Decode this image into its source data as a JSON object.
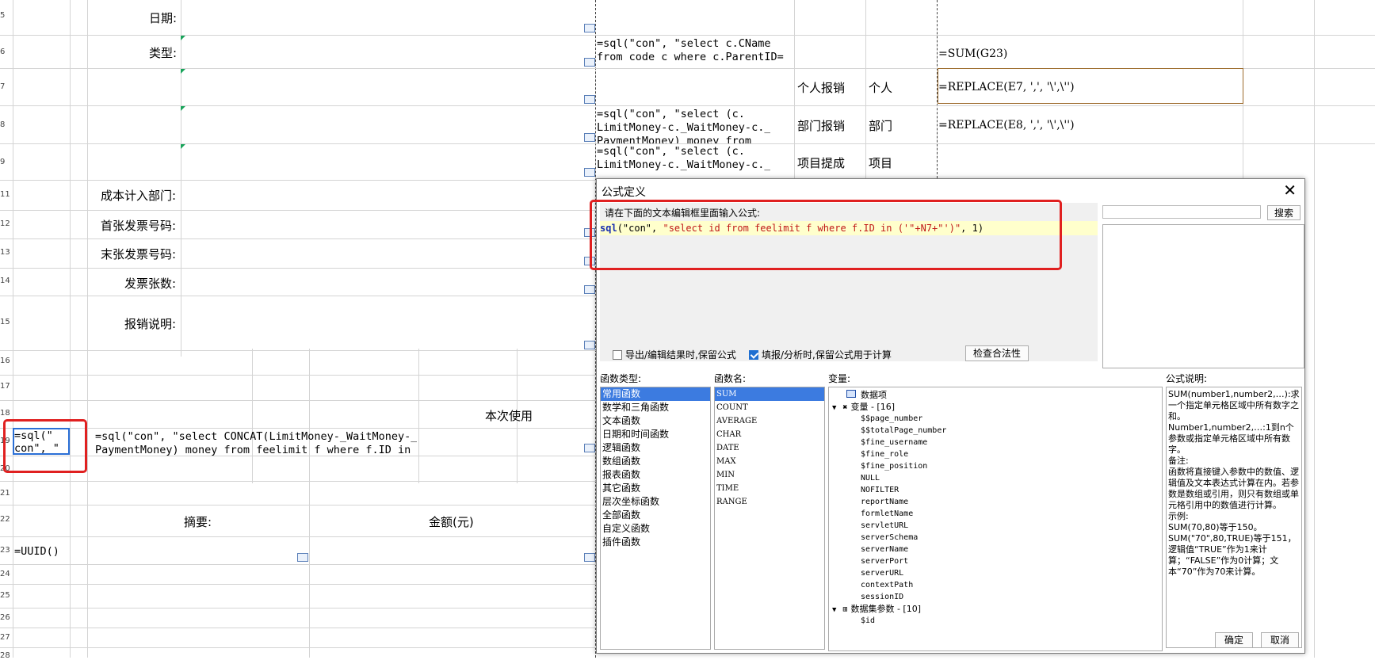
{
  "sheet": {
    "row_numbers": [
      "5",
      "6",
      "7",
      "8",
      "9",
      "11",
      "12",
      "13",
      "14",
      "15",
      "16",
      "17",
      "18",
      "19",
      "20",
      "21",
      "22",
      "23",
      "24",
      "25",
      "26",
      "27",
      "28"
    ],
    "labels": {
      "date": "日期:",
      "type": "类型:",
      "cost_dept": "成本计入部门:",
      "first_invoice": "首张发票号码:",
      "last_invoice": "末张发票号码:",
      "invoice_count": "发票张数:",
      "description": "报销说明:",
      "this_use": "本次使用",
      "summary": "摘要:",
      "amount": "金额(元)"
    },
    "formulas": {
      "r6_line1": "=sql(\"con\", \"select c.CName",
      "r6_line2": "from code c where c.ParentID=",
      "r6_sum": "=SUM(G23)",
      "r7_replace": "=REPLACE(E7, ',', '\\',\\'')",
      "r8_line1": "=sql(\"con\", \"select (c.",
      "r8_line2": "LimitMoney-c._WaitMoney-c._",
      "r8_line3": "PaymentMoney) money from",
      "r8_replace": "=REPLACE(E8, ',', '\\',\\'')",
      "r9_line1": "=sql(\"con\", \"select (c.",
      "r9_line2": "LimitMoney-c._WaitMoney-c._",
      "r19_a_line1": "=sql(\"",
      "r19_a_line2": "con\", \"",
      "r19_b_line1": "=sql(\"con\", \"select CONCAT(LimitMoney-_WaitMoney-_",
      "r19_b_line2": "PaymentMoney) money from feelimit f where f.ID in",
      "r23_uuid": "=UUID()"
    },
    "cells": {
      "personal_claim": "个人报销",
      "personal": "个人",
      "dept_claim": "部门报销",
      "dept": "部门",
      "project_claim": "项目提成",
      "project": "项目"
    }
  },
  "dialog": {
    "title": "公式定义",
    "editor_hint": "请在下面的文本编辑框里面输入公式:",
    "formula_fn": "sql",
    "formula_rest_1": "(\"con\", ",
    "formula_str": "\"select id from feelimit f where f.ID in ('\"+N7+\"')\"",
    "formula_rest_2": ", 1)",
    "search_value": "",
    "search_button": "搜索",
    "opt_keep_export": "导出/编辑结果时,保留公式",
    "opt_keep_export_checked": false,
    "opt_keep_fill": "填报/分析时,保留公式用于计算",
    "opt_keep_fill_checked": true,
    "check_button": "检查合法性",
    "func_type_label": "函数类型:",
    "func_name_label": "函数名:",
    "var_label": "变量:",
    "desc_label": "公式说明:",
    "func_types": [
      "常用函数",
      "数学和三角函数",
      "文本函数",
      "日期和时间函数",
      "逻辑函数",
      "数组函数",
      "报表函数",
      "其它函数",
      "层次坐标函数",
      "全部函数",
      "自定义函数",
      "插件函数"
    ],
    "func_types_selected": 0,
    "func_names": [
      "SUM",
      "COUNT",
      "AVERAGE",
      "CHAR",
      "DATE",
      "MAX",
      "MIN",
      "TIME",
      "RANGE"
    ],
    "func_names_selected": 0,
    "var_tree": {
      "data_item": "数据项",
      "var_group": "变量 - [16]",
      "vars": [
        "$$page_number",
        "$$totalPage_number",
        "$fine_username",
        "$fine_role",
        "$fine_position",
        "NULL",
        "NOFILTER",
        "reportName",
        "formletName",
        "servletURL",
        "serverSchema",
        "serverName",
        "serverPort",
        "serverURL",
        "contextPath",
        "sessionID"
      ],
      "dataset_group": "数据集参数 - [10]",
      "dataset_vars": [
        "$id"
      ]
    },
    "description": [
      "SUM(number1,number2,…):求一个指定单元格区域中所有数字之和。",
      "Number1,number2,…:1到n个参数或指定单元格区域中所有数字。",
      "备注:",
      "函数将直接键入参数中的数值、逻辑值及文本表达式计算在内。若参数是数组或引用，则只有数组或单元格引用中的数值进行计算。",
      "示例:",
      "SUM(70,80)等于150。",
      "SUM(\"70\",80,TRUE)等于151，逻辑值“TRUE”作为1来计算；“FALSE”作为0计算；文本“70”作为70来计算。"
    ],
    "ok_button": "确定",
    "cancel_button": "取消"
  },
  "colors": {
    "highlight_red": "#e02020",
    "selection_blue": "#3c7be0",
    "editor_yellow": "#ffffcc"
  }
}
